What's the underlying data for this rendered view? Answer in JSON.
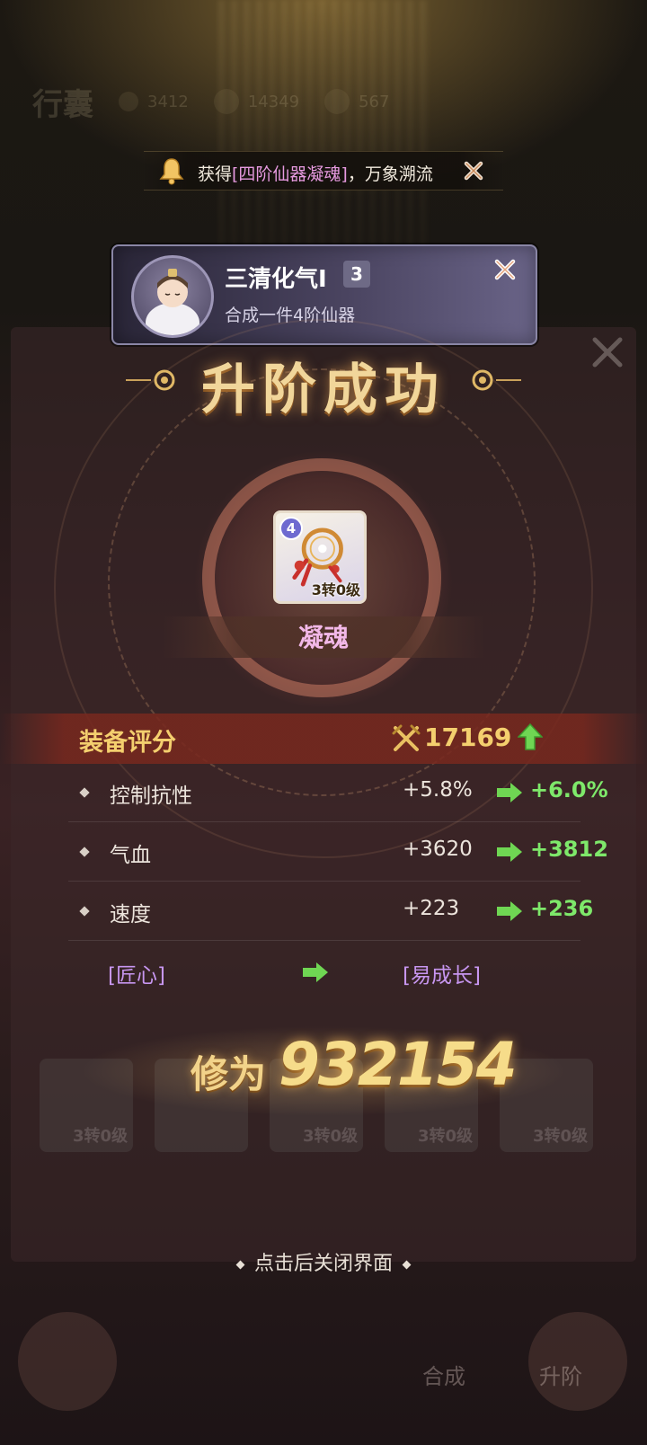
{
  "notice": {
    "prefix": "获得",
    "item": "[四阶仙器凝魂]",
    "suffix": "，万象溯流",
    "icon": "bell-icon",
    "close_icon": "close-icon"
  },
  "achievement": {
    "title": "三清化气Ⅰ",
    "level": "3",
    "subtitle": "合成一件4阶仙器"
  },
  "result": {
    "title": "升阶成功",
    "item": {
      "tier": "4",
      "level": "3转0级",
      "name": "凝魂"
    },
    "score": {
      "label": "装备评分",
      "value": "17169",
      "trend": "up"
    },
    "attributes": [
      {
        "name": "控制抗性",
        "old": "+5.8%",
        "new": "+6.0%"
      },
      {
        "name": "气血",
        "old": "+3620",
        "new": "+3812"
      },
      {
        "name": "速度",
        "old": "+223",
        "new": "+236"
      }
    ],
    "trait": {
      "old": "[匠心]",
      "new": "[易成长]"
    },
    "cultivation": {
      "label": "修为",
      "value": "932154"
    },
    "close_hint": "点击后关闭界面"
  },
  "colors": {
    "gold": "#f4cf6e",
    "green": "#7ee86a",
    "purple": "#c796f0",
    "pink": "#f2b8e8"
  }
}
